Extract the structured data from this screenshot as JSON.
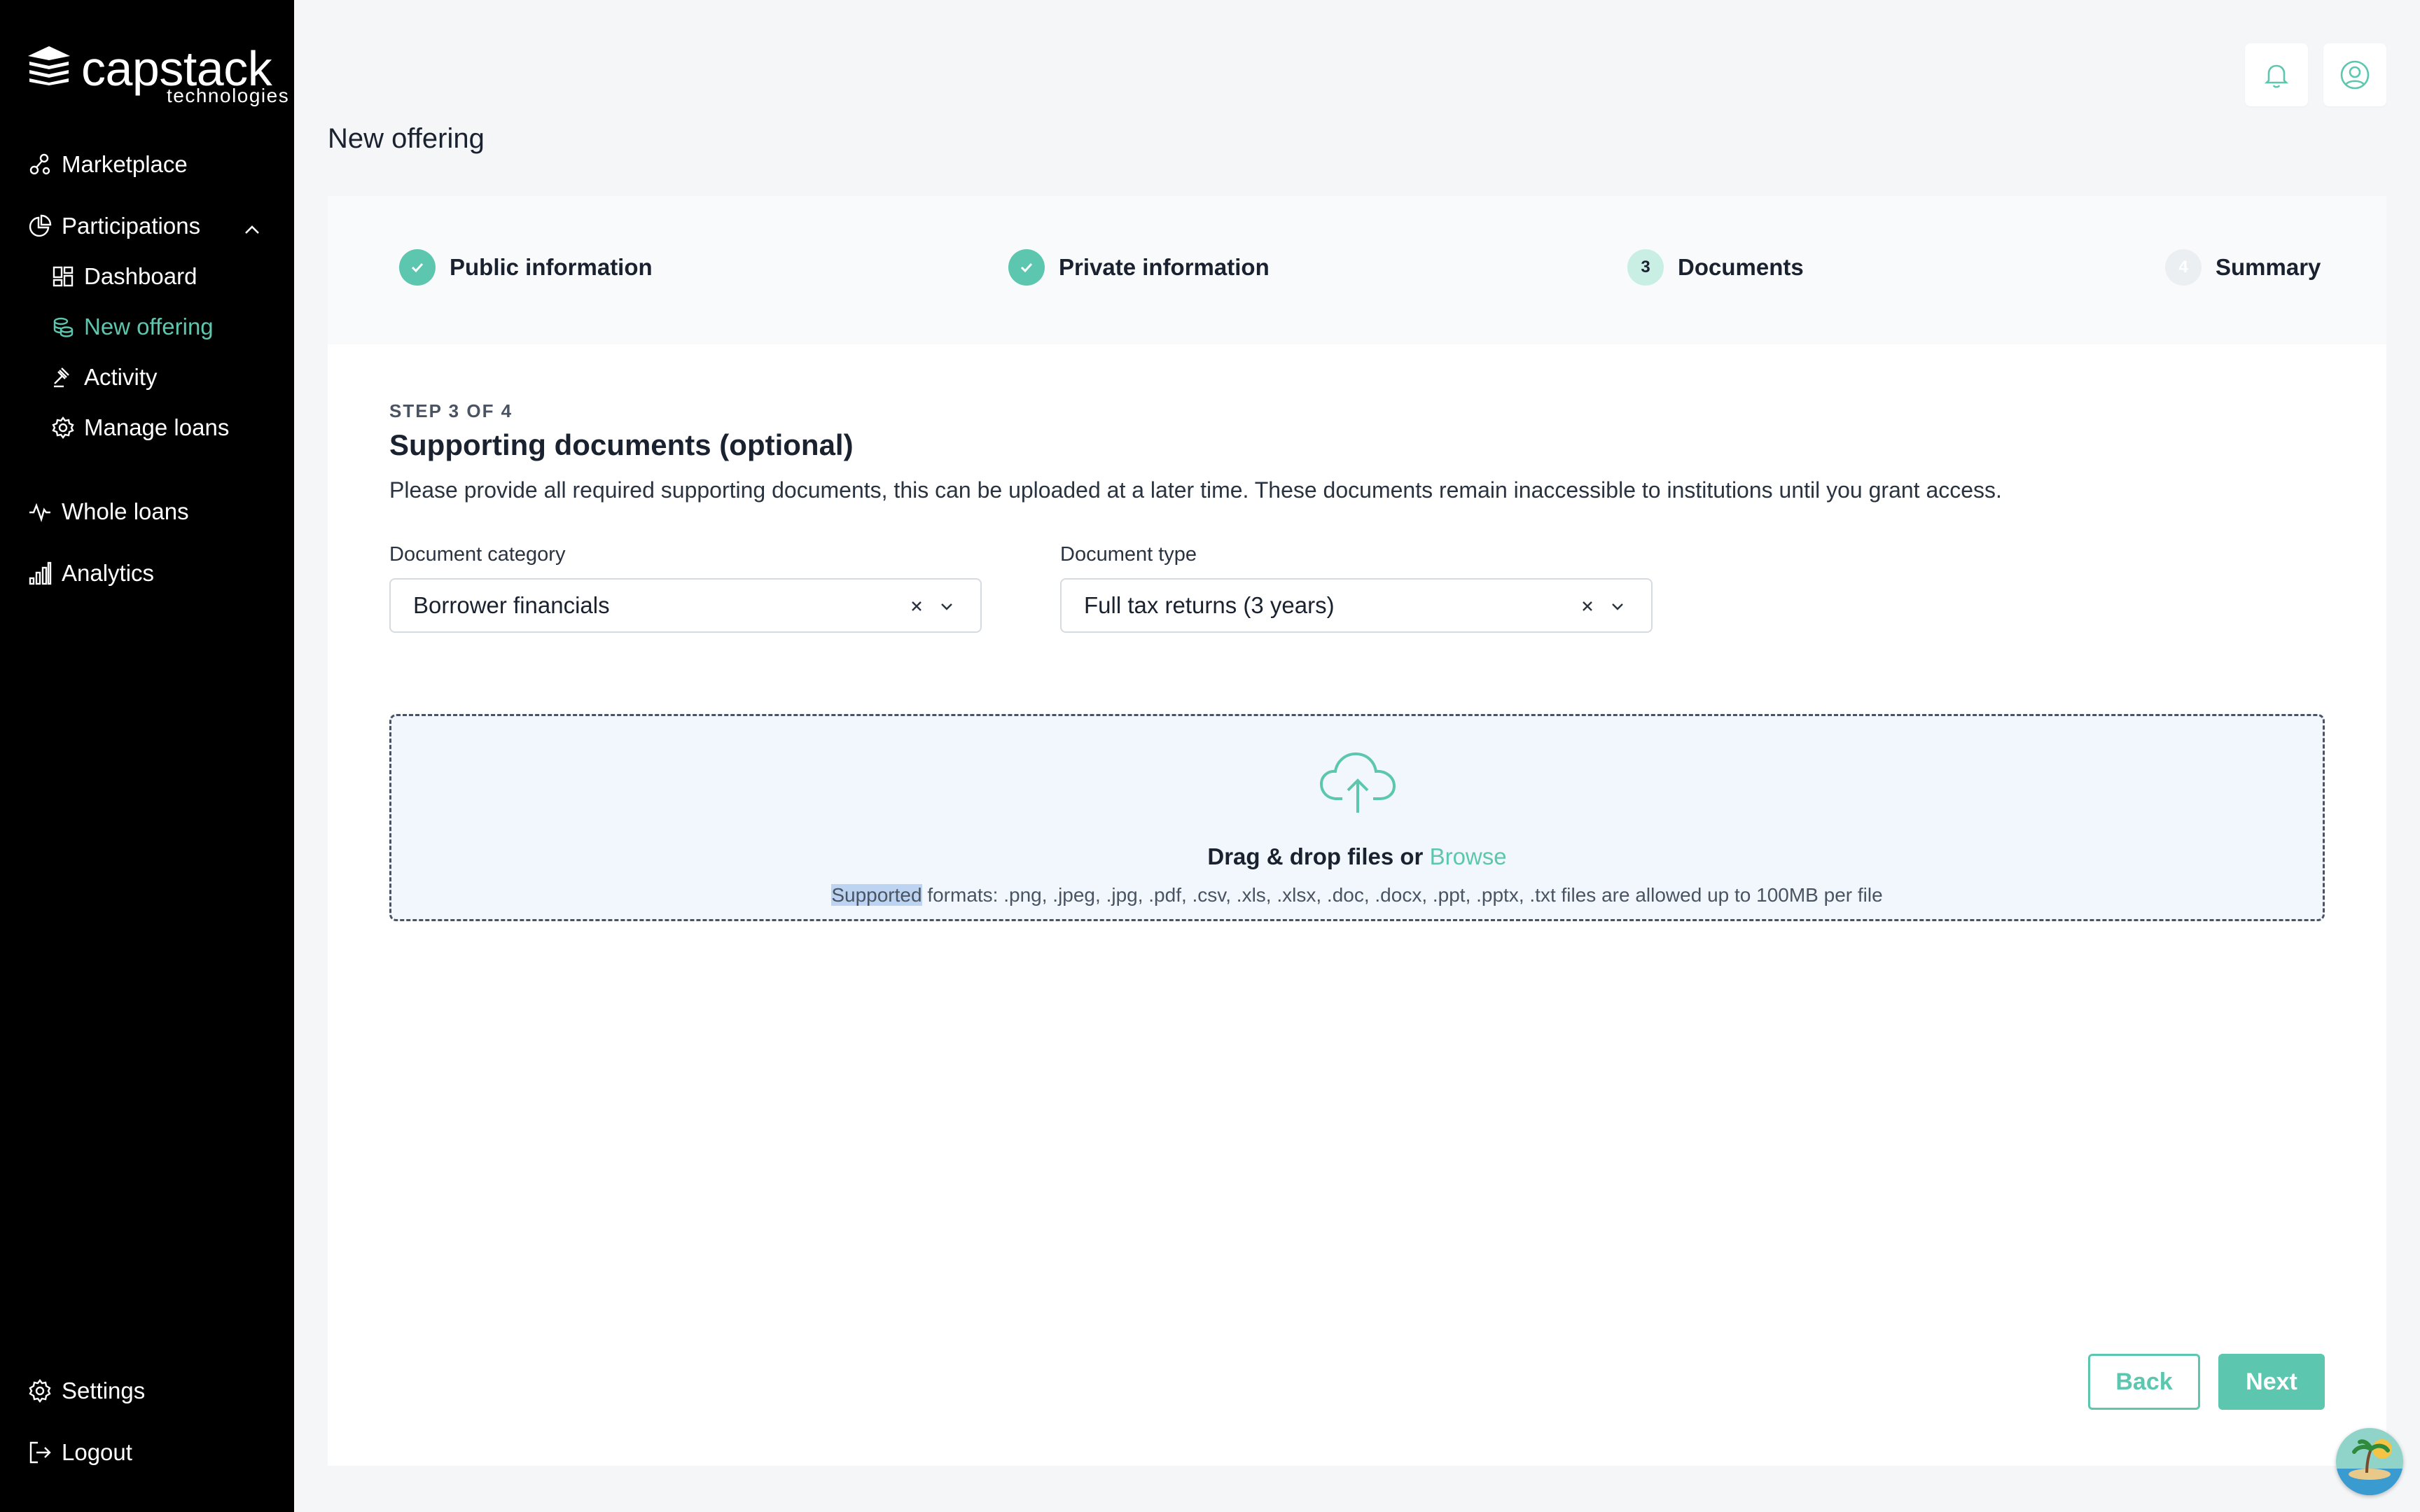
{
  "brand": {
    "name": "capstack",
    "sub": "technologies"
  },
  "sidebar": {
    "items": [
      {
        "label": "Marketplace",
        "icon": "marketplace-icon"
      },
      {
        "label": "Participations",
        "icon": "pie-chart-icon"
      },
      {
        "label": "Dashboard",
        "icon": "dashboard-icon"
      },
      {
        "label": "New offering",
        "icon": "coins-icon",
        "active": true
      },
      {
        "label": "Activity",
        "icon": "gavel-icon"
      },
      {
        "label": "Manage loans",
        "icon": "gear-badge-icon"
      },
      {
        "label": "Whole loans",
        "icon": "activity-pulse-icon"
      },
      {
        "label": "Analytics",
        "icon": "bar-chart-icon"
      }
    ],
    "bottom": [
      {
        "label": "Settings",
        "icon": "gear-icon"
      },
      {
        "label": "Logout",
        "icon": "logout-icon"
      }
    ]
  },
  "header": {
    "title": "New offering"
  },
  "stepper": {
    "steps": [
      {
        "label": "Public information",
        "status": "done"
      },
      {
        "label": "Private information",
        "status": "done"
      },
      {
        "label": "Documents",
        "status": "current",
        "number": "3"
      },
      {
        "label": "Summary",
        "status": "todo",
        "number": "4"
      }
    ]
  },
  "form": {
    "step_of": "STEP 3 OF 4",
    "title": "Supporting documents (optional)",
    "description": "Please provide all required supporting documents, this can be uploaded at a later time. These documents remain inaccessible to institutions until you grant access.",
    "category": {
      "label": "Document category",
      "value": "Borrower financials"
    },
    "type": {
      "label": "Document type",
      "value": "Full tax returns (3 years)"
    }
  },
  "dropzone": {
    "main": "Drag & drop files or",
    "browse": "Browse",
    "sub_highlight": "Supported",
    "sub_rest": " formats: .png, .jpeg, .jpg, .pdf, .csv, .xls, .xlsx, .doc, .docx, .ppt, .pptx, .txt files are allowed up to 100MB per file"
  },
  "buttons": {
    "back": "Back",
    "next": "Next"
  },
  "colors": {
    "accent": "#5cc7ae",
    "sidebar_bg": "#000000",
    "page_bg": "#f4f6f8"
  }
}
